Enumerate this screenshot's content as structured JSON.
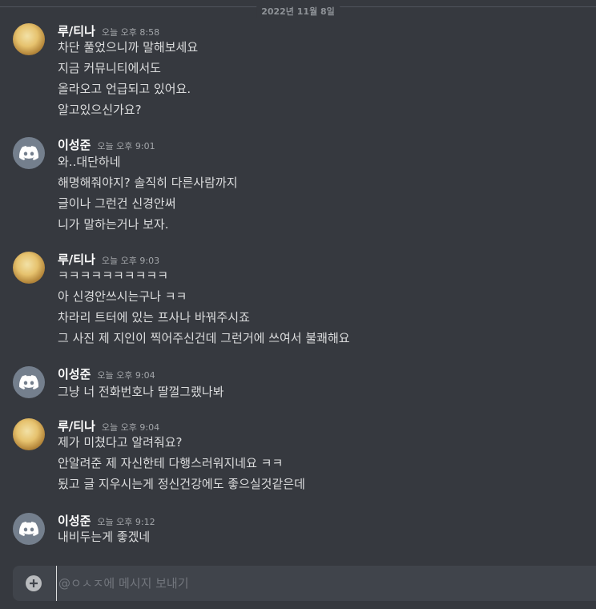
{
  "date_divider": "2022년 11월 8일",
  "messages": [
    {
      "author": "루/티나",
      "time": "오늘 오후 8:58",
      "lines": [
        "차단 풀었으니까 말해보세요",
        "지금 커뮤니티에서도",
        "올라오고 언급되고 있어요.",
        "알고있으신가요?"
      ]
    },
    {
      "author": "이성준",
      "time": "오늘 오후 9:01",
      "lines": [
        "와..대단하네",
        "해명해줘야지? 솔직히 다른사람까지",
        "글이나 그런건 신경안써",
        "니가 말하는거나 보자."
      ]
    },
    {
      "author": "루/티나",
      "time": "오늘 오후 9:03",
      "lines": [
        "ㅋㅋㅋㅋㅋㅋㅋㅋㅋㅋ",
        "아 신경안쓰시는구나 ㅋㅋ",
        "차라리 트터에 있는 프사나 바꿔주시죠",
        "그 사진 제 지인이 찍어주신건데 그런거에 쓰여서 불쾌해요"
      ]
    },
    {
      "author": "이성준",
      "time": "오늘 오후 9:04",
      "lines": [
        "그냥 너 전화번호나 딸껄그랬나봐"
      ]
    },
    {
      "author": "루/티나",
      "time": "오늘 오후 9:04",
      "lines": [
        "제가 미쳤다고 알려줘요?",
        "안알려준 제 자신한테 다행스러워지네요 ㅋㅋ",
        "됬고 글 지우시는게 정신건강에도 좋으실것같은데"
      ]
    },
    {
      "author": "이성준",
      "time": "오늘 오후 9:12",
      "lines": [
        "내비두는게 좋겠네"
      ]
    }
  ],
  "composer": {
    "placeholder": "@ㅇㅅㅈ에 메시지 보내기",
    "add_icon": "plus-circle-icon"
  },
  "colors": {
    "background": "#36393f",
    "username": "#ffffff",
    "text": "#dcddde",
    "timestamp": "#a3a6aa",
    "composer_bg": "#40444b",
    "default_avatar": "#747f8d"
  }
}
